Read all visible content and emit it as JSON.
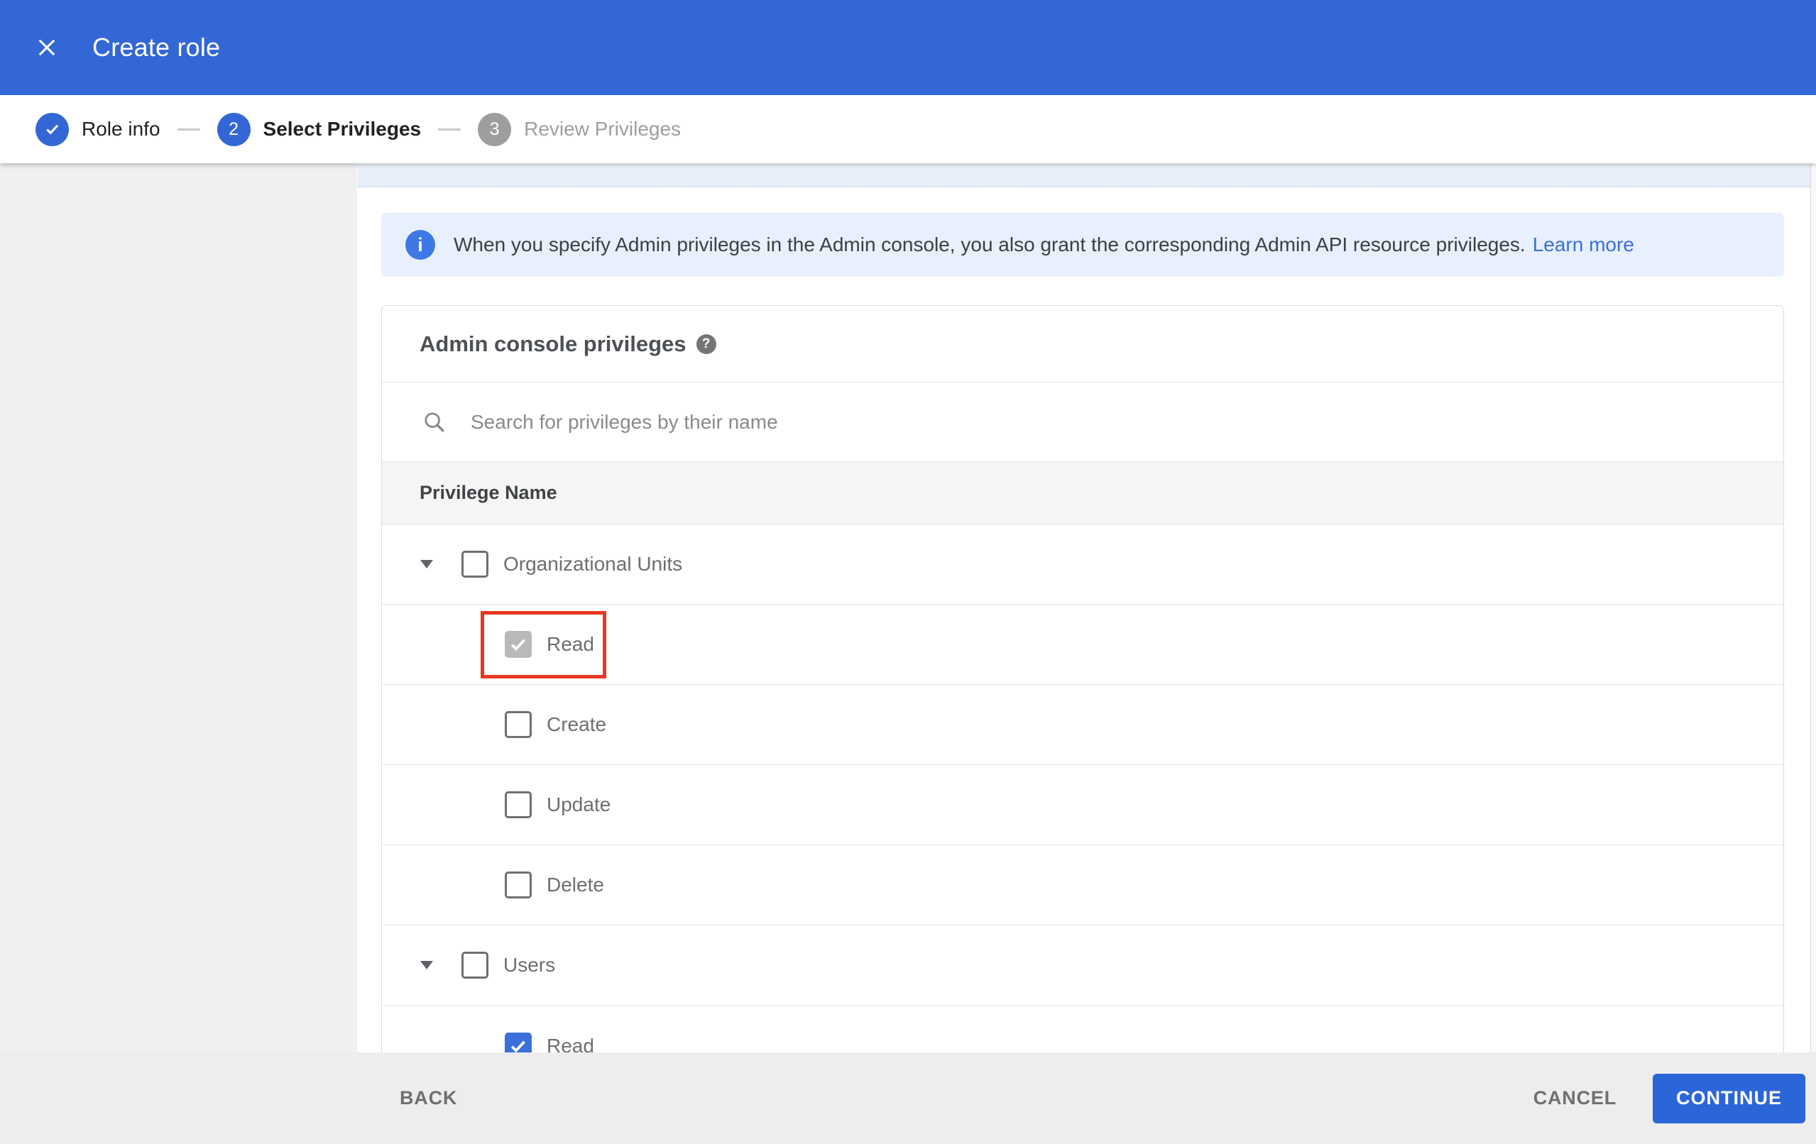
{
  "colors": {
    "appbar-blue": "#3367d6",
    "step-blue": "#3367d6",
    "step-grey": "#9e9e9e",
    "banner-bg": "#e8f0fe",
    "info-blue": "#3e78e7",
    "link-blue": "#3b6fd9",
    "cb-selected": "#3b6fd9",
    "cb-disabled": "#b9b9b9",
    "hl-red": "#e8371f",
    "continue-blue": "#2b66d9",
    "footer-bg": "#ededed",
    "sidebar-grey": "#f0f0f0",
    "thead-bg": "#f5f5f5"
  },
  "appbar": {
    "title": "Create role"
  },
  "stepper": {
    "steps": [
      {
        "number": "1",
        "label": "Role info",
        "state": "completed"
      },
      {
        "number": "2",
        "label": "Select Privileges",
        "state": "active"
      },
      {
        "number": "3",
        "label": "Review Privileges",
        "state": "upcoming"
      }
    ]
  },
  "banner": {
    "text": "When you specify Admin privileges in the Admin console, you also grant the corresponding Admin API resource privileges.",
    "link_label": "Learn more"
  },
  "panel": {
    "heading": "Admin console privileges",
    "search_placeholder": "Search for privileges by their name",
    "column_header": "Privilege Name",
    "rows": [
      {
        "label": "Organizational Units",
        "level": "parent",
        "expanded": true,
        "checkbox": "unchecked"
      },
      {
        "label": "Read",
        "level": "child",
        "checkbox": "checked-disabled",
        "highlighted": true
      },
      {
        "label": "Create",
        "level": "child",
        "checkbox": "unchecked"
      },
      {
        "label": "Update",
        "level": "child",
        "checkbox": "unchecked"
      },
      {
        "label": "Delete",
        "level": "child",
        "checkbox": "unchecked"
      },
      {
        "label": "Users",
        "level": "parent",
        "expanded": true,
        "checkbox": "unchecked"
      },
      {
        "label": "Read",
        "level": "child",
        "checkbox": "checked-selected",
        "clipped": true
      }
    ]
  },
  "footer": {
    "back_label": "BACK",
    "cancel_label": "CANCEL",
    "continue_label": "CONTINUE"
  }
}
